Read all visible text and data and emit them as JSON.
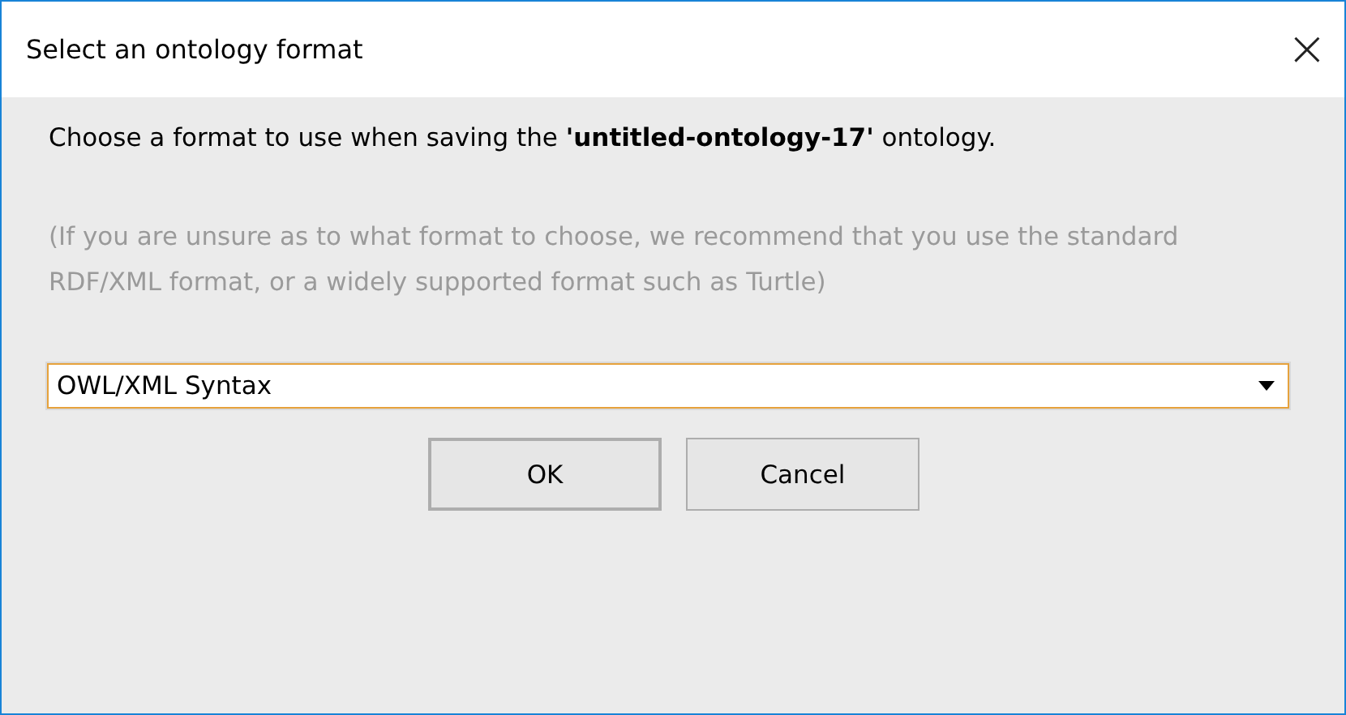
{
  "window": {
    "title": "Select an ontology format",
    "close": "×"
  },
  "message": "Choose a format to use when saving the **'untitled-ontology-17'** ontology.",
  "hint": "(If you are unsure as to what format to choose, we recommend that you use the standard RDF/XML format, or a widely supported format such as Turtle)",
  "format_dropdown": {
    "value": "OWL/XML Syntax",
    "focused": true
  },
  "buttons": [
    {
      "label": "OK",
      "default": true
    },
    {
      "label": "Cancel",
      "default": false
    }
  ]
}
